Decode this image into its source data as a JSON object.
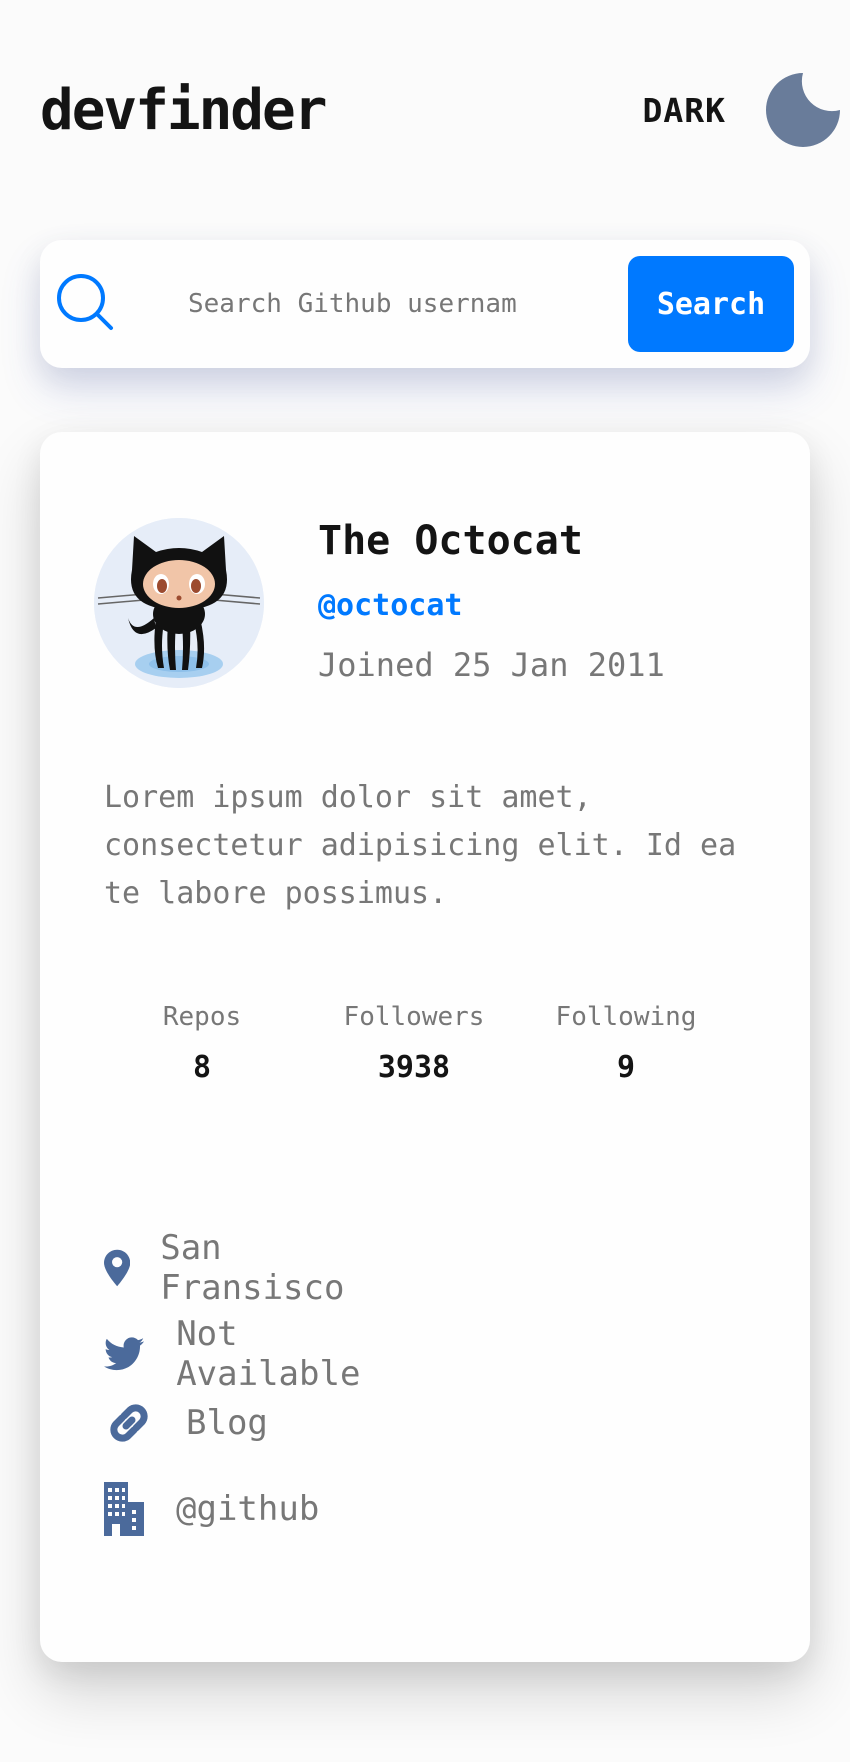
{
  "app": {
    "title": "devfinder"
  },
  "theme_toggle": {
    "label": "DARK",
    "icon": "moon-icon"
  },
  "search": {
    "placeholder": "Search Github usernam",
    "button_label": "Search"
  },
  "profile": {
    "name": "The Octocat",
    "login": "@octocat",
    "joined": "Joined 25 Jan 2011",
    "bio": "Lorem ipsum dolor sit amet, consectetur adipisicing elit. Id ea te labore possimus."
  },
  "stats": [
    {
      "label": "Repos",
      "value": "8"
    },
    {
      "label": "Followers",
      "value": "3938"
    },
    {
      "label": "Following",
      "value": "9"
    }
  ],
  "links": {
    "location": "San Fransisco",
    "twitter": "Not Available",
    "blog": "Blog",
    "company": "@github"
  },
  "colors": {
    "accent": "#0079ff",
    "icon": "#4b6a9b",
    "moon": "#697c9a",
    "text_primary": "#141414",
    "text_secondary": "#777777"
  }
}
